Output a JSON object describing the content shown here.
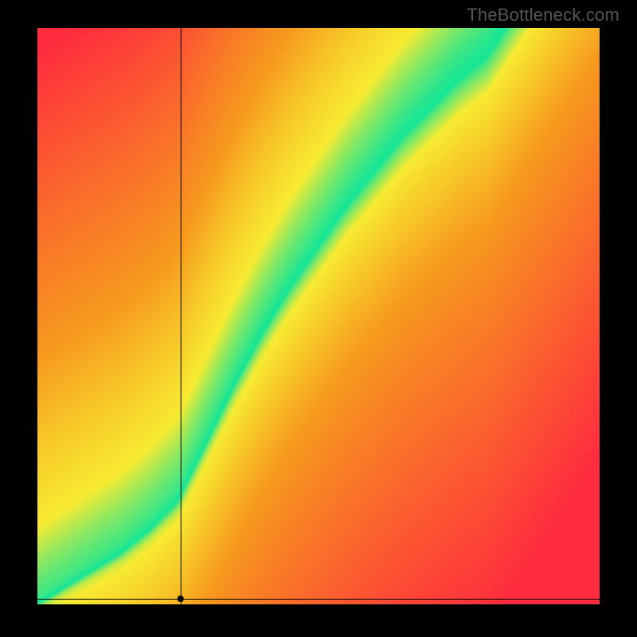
{
  "watermark": "TheBottleneck.com",
  "colors": {
    "background": "#000000",
    "label": "#555555"
  },
  "chart_data": {
    "type": "heatmap",
    "title": "",
    "xlabel": "",
    "ylabel": "",
    "xlim": [
      0,
      100
    ],
    "ylim": [
      0,
      100
    ],
    "grid": false,
    "legend": "none",
    "ridge": {
      "description": "Optimal-balance ridge (green band) through the heatmap; points are (x, y) on 0–100 axes",
      "points": [
        [
          0,
          0
        ],
        [
          5,
          3
        ],
        [
          10,
          6
        ],
        [
          15,
          9
        ],
        [
          20,
          13
        ],
        [
          25,
          18
        ],
        [
          28,
          24
        ],
        [
          31,
          30
        ],
        [
          35,
          38
        ],
        [
          40,
          47
        ],
        [
          45,
          55
        ],
        [
          50,
          62
        ],
        [
          55,
          69
        ],
        [
          60,
          75
        ],
        [
          65,
          81
        ],
        [
          70,
          86
        ],
        [
          75,
          91
        ],
        [
          80,
          95
        ],
        [
          82,
          98
        ]
      ],
      "width_start": 2,
      "width_end": 10
    },
    "marker": {
      "x": 25.5,
      "y": 0
    },
    "axis_lines": {
      "vertical_at_x": 25.5,
      "horizontal_at_y": 0
    },
    "palette": {
      "optimal": "#17E696",
      "near": "#F7EB32",
      "mid": "#F79A1E",
      "far": "#FF2B3F"
    }
  }
}
